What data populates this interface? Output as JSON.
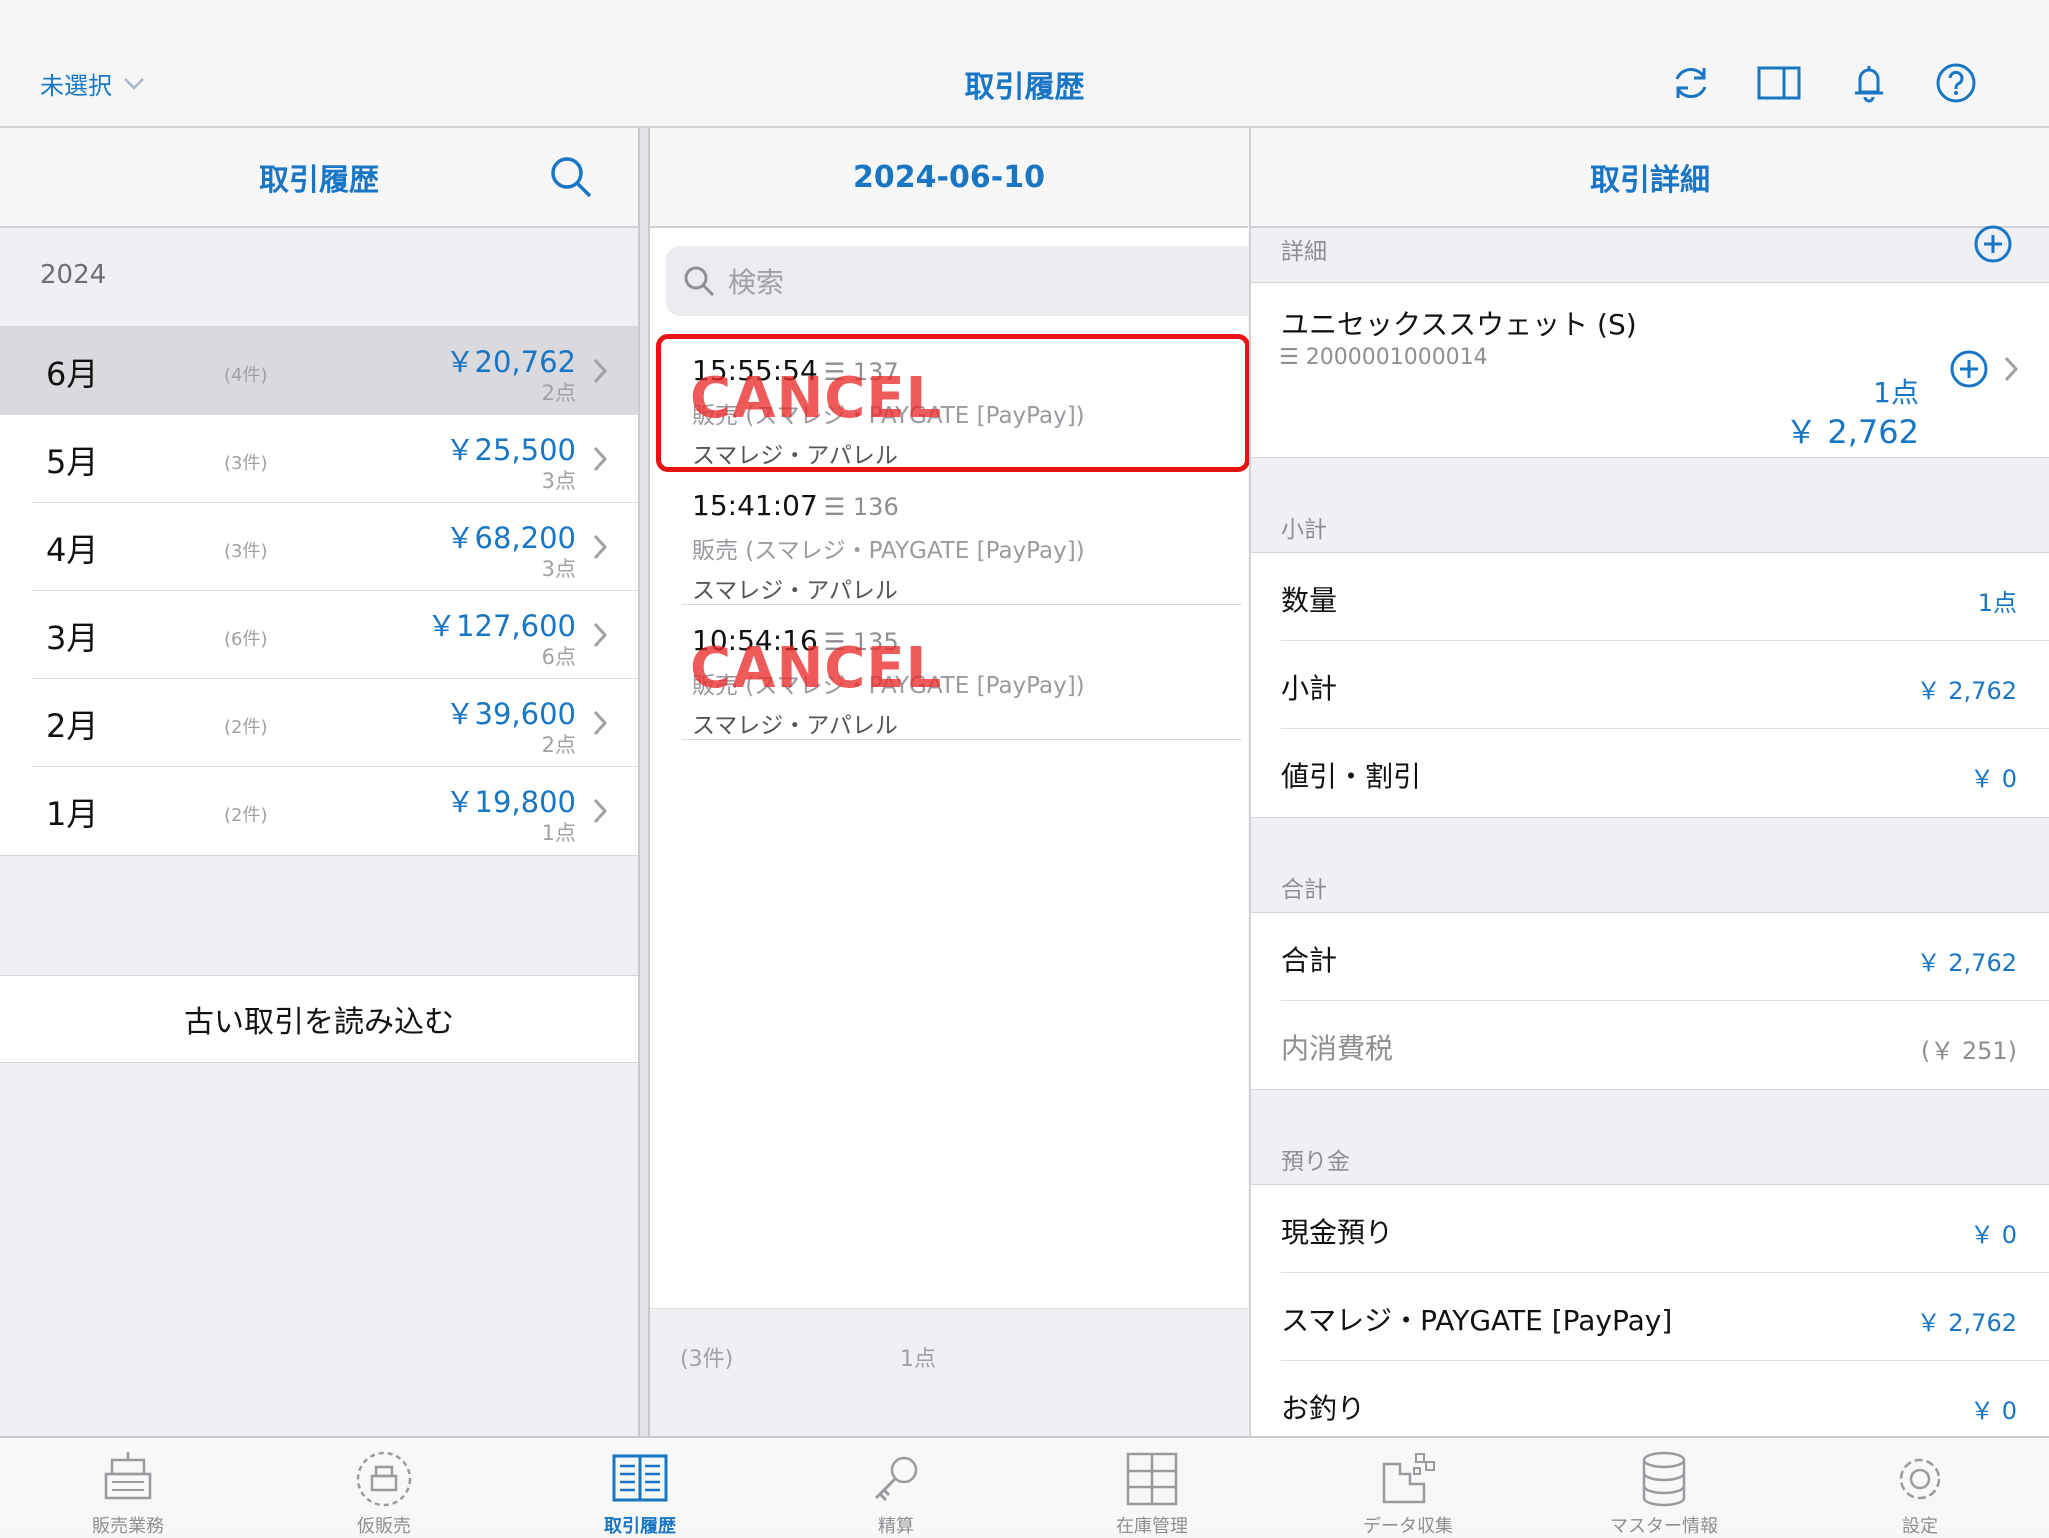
{
  "topbar": {
    "store_selector": "未選択",
    "title": "取引履歴",
    "icons": [
      "refresh-icon",
      "split-view-icon",
      "bell-icon",
      "help-icon"
    ]
  },
  "left": {
    "header": "取引履歴",
    "year": "2024",
    "months": [
      {
        "name": "6月",
        "count": "(4件)",
        "amount": "￥20,762",
        "points": "2点"
      },
      {
        "name": "5月",
        "count": "(3件)",
        "amount": "￥25,500",
        "points": "3点"
      },
      {
        "name": "4月",
        "count": "(3件)",
        "amount": "￥68,200",
        "points": "3点"
      },
      {
        "name": "3月",
        "count": "(6件)",
        "amount": "￥127,600",
        "points": "6点"
      },
      {
        "name": "2月",
        "count": "(2件)",
        "amount": "￥39,600",
        "points": "2点"
      },
      {
        "name": "1月",
        "count": "(2件)",
        "amount": "￥19,800",
        "points": "1点"
      }
    ],
    "load_old": "古い取引を読み込む"
  },
  "middle": {
    "header": "2024-06-10",
    "search_placeholder": "検索",
    "transactions": [
      {
        "time": "15:55:54",
        "no": "☰ 137",
        "type": "販売 (スマレジ・PAYGATE [PayPay])",
        "shop": "スマレジ・アパレル",
        "stamp": "CANCEL"
      },
      {
        "time": "15:41:07",
        "no": "☰ 136",
        "type": "販売 (スマレジ・PAYGATE [PayPay])",
        "shop": "スマレジ・アパレル",
        "stamp": ""
      },
      {
        "time": "10:54:16",
        "no": "☰ 135",
        "type": "販売 (スマレジ・PAYGATE [PayPay])",
        "shop": "スマレジ・アパレル",
        "stamp": "CANCEL"
      }
    ],
    "footer_count": "(3件)",
    "footer_points": "1点"
  },
  "right": {
    "header": "取引詳細",
    "details_label": "詳細",
    "item": {
      "name": "ユニセックススウェット (S)",
      "code": "☰ 2000001000014",
      "qty": "1点",
      "price": "￥ 2,762"
    },
    "subtotal_label": "小計",
    "subtotal_rows": [
      {
        "label": "数量",
        "value": "1点"
      },
      {
        "label": "小計",
        "value": "￥ 2,762"
      },
      {
        "label": "値引・割引",
        "value": "￥ 0"
      }
    ],
    "total_label": "合計",
    "total_rows": [
      {
        "label": "合計",
        "value": "￥ 2,762"
      },
      {
        "label": "内消費税",
        "value": "(￥ 251)"
      }
    ],
    "deposit_label": "預り金",
    "deposit_rows": [
      {
        "label": "現金預り",
        "value": "￥ 0"
      },
      {
        "label": "スマレジ・PAYGATE [PayPay]",
        "value": "￥ 2,762"
      },
      {
        "label": "お釣り",
        "value": "￥ 0"
      }
    ]
  },
  "tabbar": [
    {
      "label": "販売業務",
      "icon": "register-icon"
    },
    {
      "label": "仮販売",
      "icon": "temp-sale-icon"
    },
    {
      "label": "取引履歴",
      "icon": "history-book-icon",
      "active": true
    },
    {
      "label": "精算",
      "icon": "key-icon"
    },
    {
      "label": "在庫管理",
      "icon": "inventory-icon"
    },
    {
      "label": "データ収集",
      "icon": "data-collect-icon"
    },
    {
      "label": "マスター情報",
      "icon": "database-icon"
    },
    {
      "label": "設定",
      "icon": "gear-icon"
    }
  ],
  "colors": {
    "accent": "#1976c4",
    "cancel": "#e81414",
    "background": "#efeff4"
  }
}
